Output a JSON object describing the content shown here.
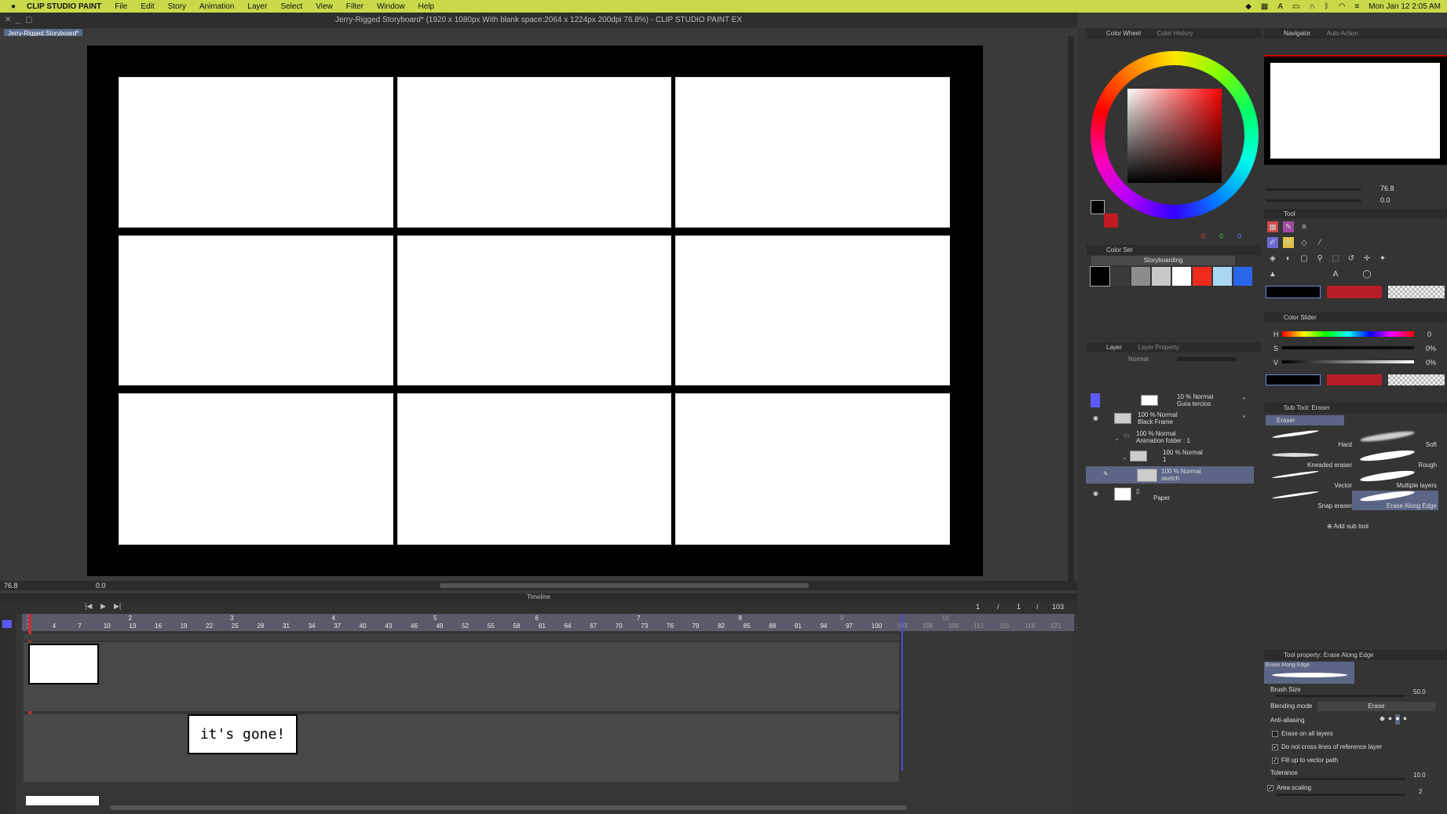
{
  "menubar": {
    "apple": "",
    "app_name": "CLIP STUDIO PAINT",
    "items": [
      "File",
      "Edit",
      "Story",
      "Animation",
      "Layer",
      "Select",
      "View",
      "Filter",
      "Window",
      "Help"
    ],
    "clock": "Mon Jan 12  2:05 AM"
  },
  "window": {
    "title": "Jerry-Rigged Storyboard* (1920 x 1080px With blank space:2064 x 1224px 200dpi 76.8%)  - CLIP STUDIO PAINT EX",
    "doc_tab": "Jerry-Rigged Storyboard*"
  },
  "canvas_status": {
    "zoom": "76.8",
    "rotation": "0.0"
  },
  "timeline": {
    "title": "Timeline",
    "frame_current": "1",
    "frame_sep": "/",
    "frame_total_a": "1",
    "frame_total_b": "103",
    "ruler_numbers": [
      "1",
      "4",
      "7",
      "10",
      "13",
      "16",
      "19",
      "22",
      "25",
      "28",
      "31",
      "34",
      "37",
      "40",
      "43",
      "46",
      "49",
      "52",
      "55",
      "58",
      "61",
      "64",
      "67",
      "70",
      "73",
      "76",
      "79",
      "82",
      "85",
      "88",
      "91",
      "94",
      "97",
      "100",
      "103",
      "106",
      "109",
      "112",
      "115",
      "118",
      "121",
      "12"
    ],
    "section_labels": [
      "1",
      "2",
      "3",
      "4",
      "5",
      "6",
      "7",
      "8",
      "9",
      "10"
    ],
    "cel_text": "it's gone!"
  },
  "color_wheel": {
    "tab1": "Color Wheel",
    "tab2": "Color History",
    "rgb": [
      "0",
      "0",
      "0"
    ]
  },
  "color_set": {
    "title": "Color Set",
    "set_name": "Storyboarding",
    "swatches": [
      "#000000",
      "#3a3a3a",
      "#8c8c8c",
      "#c8c8c8",
      "#ffffff",
      "#ee2b1c",
      "#a9d6f0",
      "#2a66e8"
    ]
  },
  "layer": {
    "tab1": "Layer",
    "tab2": "Layer Property",
    "blend": "Normal",
    "rows": [
      {
        "l1": "10 % Normal",
        "l2": "Guía tercios"
      },
      {
        "l1": "100 % Normal",
        "l2": "Black Frame"
      },
      {
        "l1": "100 % Normal",
        "l2": "Animation folder : 1"
      },
      {
        "l1": "100 % Normal",
        "l2": "1"
      },
      {
        "l1": "100 % Normal",
        "l2": "sketch"
      },
      {
        "l1": "",
        "l2": "Paper"
      }
    ]
  },
  "navigator": {
    "tab1": "Navigator",
    "tab2": "Auto Action",
    "zoom": "76.8",
    "rotate": "0.0"
  },
  "tool": {
    "title": "Tool"
  },
  "color_slider": {
    "title": "Color Slider",
    "h_label": "H",
    "h_value": "0",
    "s_label": "S",
    "s_value": "0%",
    "v_label": "V",
    "v_value": "0%"
  },
  "subtool": {
    "title": "Sub Tool: Eraser",
    "group": "Eraser",
    "brushes": [
      "Hard",
      "Soft",
      "Kneaded eraser",
      "Rough",
      "Vector",
      "Multiple layers",
      "Snap eraser",
      "Erase Along Edge"
    ],
    "add": "Add sub tool"
  },
  "tool_property": {
    "title": "Tool property: Erase Along Edge",
    "preview_label": "Erase Along Edge",
    "brush_size_label": "Brush Size",
    "brush_size": "50.0",
    "blending_label": "Blending mode",
    "blending_value": "Erase",
    "antialias_label": "Anti-aliasing",
    "erase_all": "Erase on all layers",
    "no_cross": "Do not cross lines of reference layer",
    "fill_vector": "Fill up to vector path",
    "tolerance_label": "Tolerance",
    "tolerance": "10.0",
    "area_scaling": "Area scaling",
    "area_value": "2"
  }
}
